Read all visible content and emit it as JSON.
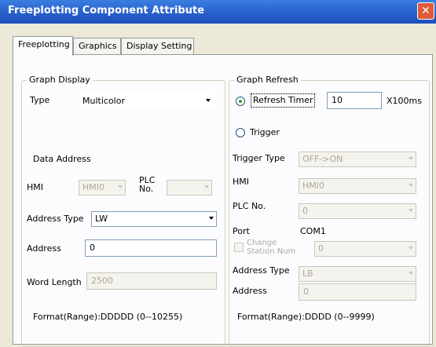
{
  "window": {
    "title": "Freeplotting Component Attribute",
    "close_symbol": "✕"
  },
  "tabs": [
    {
      "label": "Freeplotting",
      "active": true
    },
    {
      "label": "Graphics",
      "active": false
    },
    {
      "label": "Display Setting",
      "active": false
    }
  ],
  "graph_display": {
    "title": "Graph Display",
    "type_label": "Type",
    "type_value": "Multicolor",
    "data_address_label": "Data Address",
    "hmi_label": "HMI",
    "hmi_value": "HMI0",
    "plc_no_label_line1": "PLC",
    "plc_no_label_line2": "No.",
    "plc_no_value": "",
    "address_type_label": "Address Type",
    "address_type_value": "LW",
    "address_label": "Address",
    "address_value": "0",
    "word_length_label": "Word Length",
    "word_length_value": "2500",
    "format_text": "Format(Range):DDDDD (0--10255)"
  },
  "graph_refresh": {
    "title": "Graph Refresh",
    "refresh_timer_label": "Refresh Timer",
    "refresh_timer_value": "10",
    "refresh_unit": "X100ms",
    "trigger_label": "Trigger",
    "trigger_type_label": "Trigger Type",
    "trigger_type_value": "OFF->ON",
    "hmi_label": "HMI",
    "hmi_value": "HMI0",
    "plc_no_label": "PLC No.",
    "plc_no_value": "0",
    "port_label": "Port",
    "port_value": "COM1",
    "change_station_line1": "Change",
    "change_station_line2": "Station Num",
    "change_station_value": "0",
    "address_type_label": "Address Type",
    "address_type_value": "LB",
    "address_label": "Address",
    "address_value": "0",
    "format_text": "Format(Range):DDDD (0--9999)"
  }
}
